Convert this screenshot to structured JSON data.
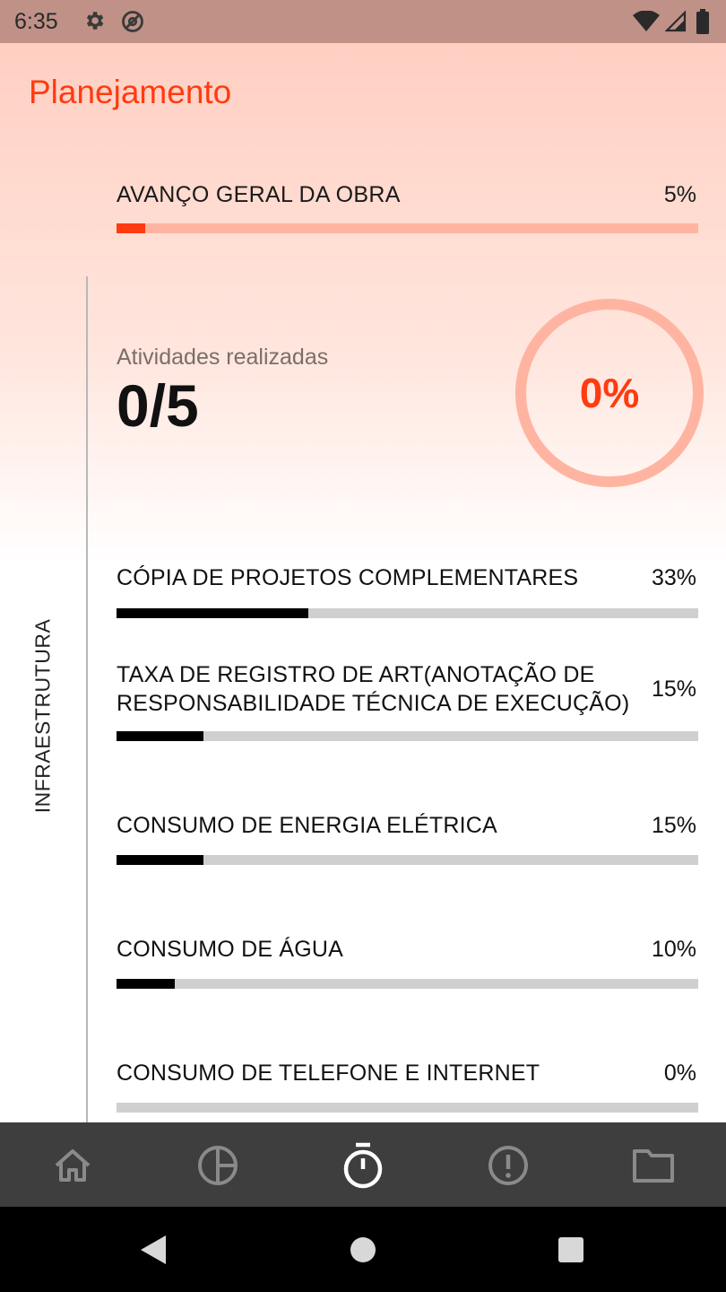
{
  "status_bar": {
    "time": "6:35",
    "icons": [
      "settings-icon",
      "at-icon",
      "wifi-icon",
      "signal-icon",
      "battery-icon"
    ]
  },
  "app": {
    "title": "Planejamento"
  },
  "overall": {
    "label": "AVANÇO GERAL DA OBRA",
    "percent_text": "5%",
    "progress": 5
  },
  "section": {
    "label": "INFRAESTRUTURA"
  },
  "summary": {
    "label": "Atividades realizadas",
    "count": "0/5",
    "ring_percent": "0%"
  },
  "activities": [
    {
      "name": "CÓPIA DE PROJETOS COMPLEMENTARES",
      "percent_text": "33%",
      "progress": 33
    },
    {
      "name": "TAXA DE REGISTRO DE ART(ANOTAÇÃO DE RESPONSABILIDADE TÉCNICA DE EXECUÇÃO)",
      "percent_text": "15%",
      "progress": 15
    },
    {
      "name": "CONSUMO DE ENERGIA ELÉTRICA",
      "percent_text": "15%",
      "progress": 15
    },
    {
      "name": "CONSUMO DE ÁGUA",
      "percent_text": "10%",
      "progress": 10
    },
    {
      "name": "CONSUMO DE TELEFONE E INTERNET",
      "percent_text": "0%",
      "progress": 0
    }
  ],
  "bottom_nav": {
    "items": [
      {
        "icon": "home-icon",
        "active": false
      },
      {
        "icon": "pie-chart-icon",
        "active": false
      },
      {
        "icon": "stopwatch-icon",
        "active": true
      },
      {
        "icon": "alert-icon",
        "active": false
      },
      {
        "icon": "folder-icon",
        "active": false
      }
    ]
  },
  "colors": {
    "accent": "#ff3b10",
    "accent_light": "#ffb4a1",
    "nav_bg": "#3e3e3e",
    "nav_inactive": "#8a8a8a",
    "nav_active": "#ffffff"
  }
}
